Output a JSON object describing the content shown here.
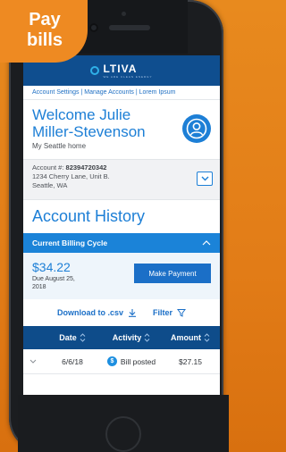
{
  "badge": {
    "line1": "Pay",
    "line2": "bills"
  },
  "header": {
    "logo_text": "LTIVA",
    "logo_sub": "WE ARE CLEAN ENERGY"
  },
  "links": {
    "text": "Account Settings | Manage Accounts | Lorem Ipsum"
  },
  "welcome": {
    "title": "Welcome Julie Miller-Stevenson",
    "subtitle": "My Seattle home"
  },
  "account": {
    "label": "Account #:",
    "number": "82394720342",
    "address1": "1234 Cherry Lane, Unit B.",
    "address2": "Seattle, WA"
  },
  "history": {
    "title": "Account History"
  },
  "cycle": {
    "label": "Current Billing Cycle"
  },
  "billing": {
    "amount": "$34.22",
    "due": "Due August 25, 2018",
    "pay_label": "Make Payment"
  },
  "actions": {
    "download_label": "Download to .csv",
    "filter_label": "Filter"
  },
  "table": {
    "headers": [
      "Date",
      "Activity",
      "Amount"
    ],
    "rows": [
      {
        "date": "6/6/18",
        "activity": "Bill posted",
        "amount": "$27.15"
      }
    ]
  },
  "colors": {
    "brand": "#0f4e8f",
    "accent": "#1d7fd6",
    "background": "#e88a1e"
  },
  "icons": [
    "user-icon",
    "chevron-down-icon",
    "chevron-up-icon",
    "download-icon",
    "filter-icon",
    "sort-icon",
    "dollar-icon"
  ]
}
